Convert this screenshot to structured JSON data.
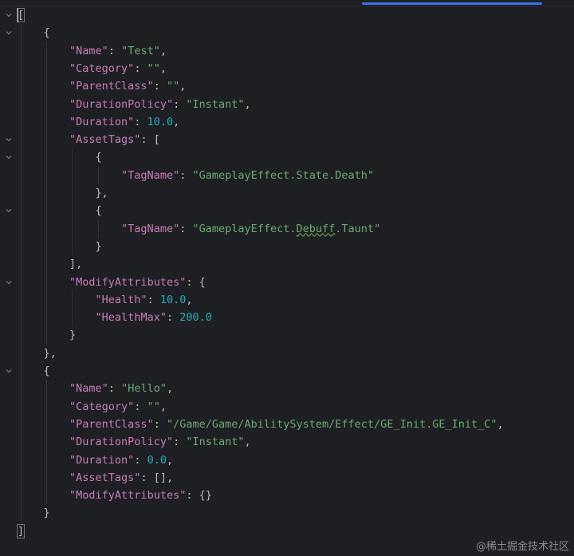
{
  "editor": {
    "lines": [
      [
        "[",
        ""
      ],
      [
        "    {",
        ""
      ],
      [
        "        \"Name\"",
        ": ",
        "\"Test\"",
        ","
      ],
      [
        "        \"Category\"",
        ": ",
        "\"\"",
        ","
      ],
      [
        "        \"ParentClass\"",
        ": ",
        "\"\"",
        ","
      ],
      [
        "        \"DurationPolicy\"",
        ": ",
        "\"Instant\"",
        ","
      ],
      [
        "        \"Duration\"",
        ": ",
        "10.0",
        ","
      ],
      [
        "        \"AssetTags\"",
        ": [",
        "",
        ""
      ],
      [
        "            {",
        ""
      ],
      [
        "                \"TagName\"",
        ": ",
        "\"GameplayEffect.State.Death\"",
        ""
      ],
      [
        "            },",
        ""
      ],
      [
        "            {",
        ""
      ],
      [
        "                \"TagName\"",
        ": ",
        "\"GameplayEffect.Debuff.Taunt\"",
        ""
      ],
      [
        "            }",
        ""
      ],
      [
        "        ],",
        ""
      ],
      [
        "        \"ModifyAttributes\"",
        ": {",
        "",
        ""
      ],
      [
        "            \"Health\"",
        ": ",
        "10.0",
        ","
      ],
      [
        "            \"HealthMax\"",
        ": ",
        "200.0",
        ""
      ],
      [
        "        }",
        ""
      ],
      [
        "    },",
        ""
      ],
      [
        "    {",
        ""
      ],
      [
        "        \"Name\"",
        ": ",
        "\"Hello\"",
        ","
      ],
      [
        "        \"Category\"",
        ": ",
        "\"\"",
        ","
      ],
      [
        "        \"ParentClass\"",
        ": ",
        "\"/Game/Game/AbilitySystem/Effect/GE_Init.GE_Init_C\"",
        ","
      ],
      [
        "        \"DurationPolicy\"",
        ": ",
        "\"Instant\"",
        ","
      ],
      [
        "        \"Duration\"",
        ": ",
        "0.0",
        ","
      ],
      [
        "        \"AssetTags\"",
        ": [],",
        "",
        ""
      ],
      [
        "        \"ModifyAttributes\"",
        ": {}",
        "",
        ""
      ],
      [
        "    }",
        ""
      ],
      [
        "]",
        ""
      ]
    ]
  },
  "watermark": "@稀土掘金技术社区",
  "colors": {
    "background": "#1e1f22",
    "key": "#c77dbb",
    "string": "#6aab73",
    "number": "#2aacb8",
    "punctuation": "#bcbec4",
    "scroll_indicator": "#3574f0"
  }
}
